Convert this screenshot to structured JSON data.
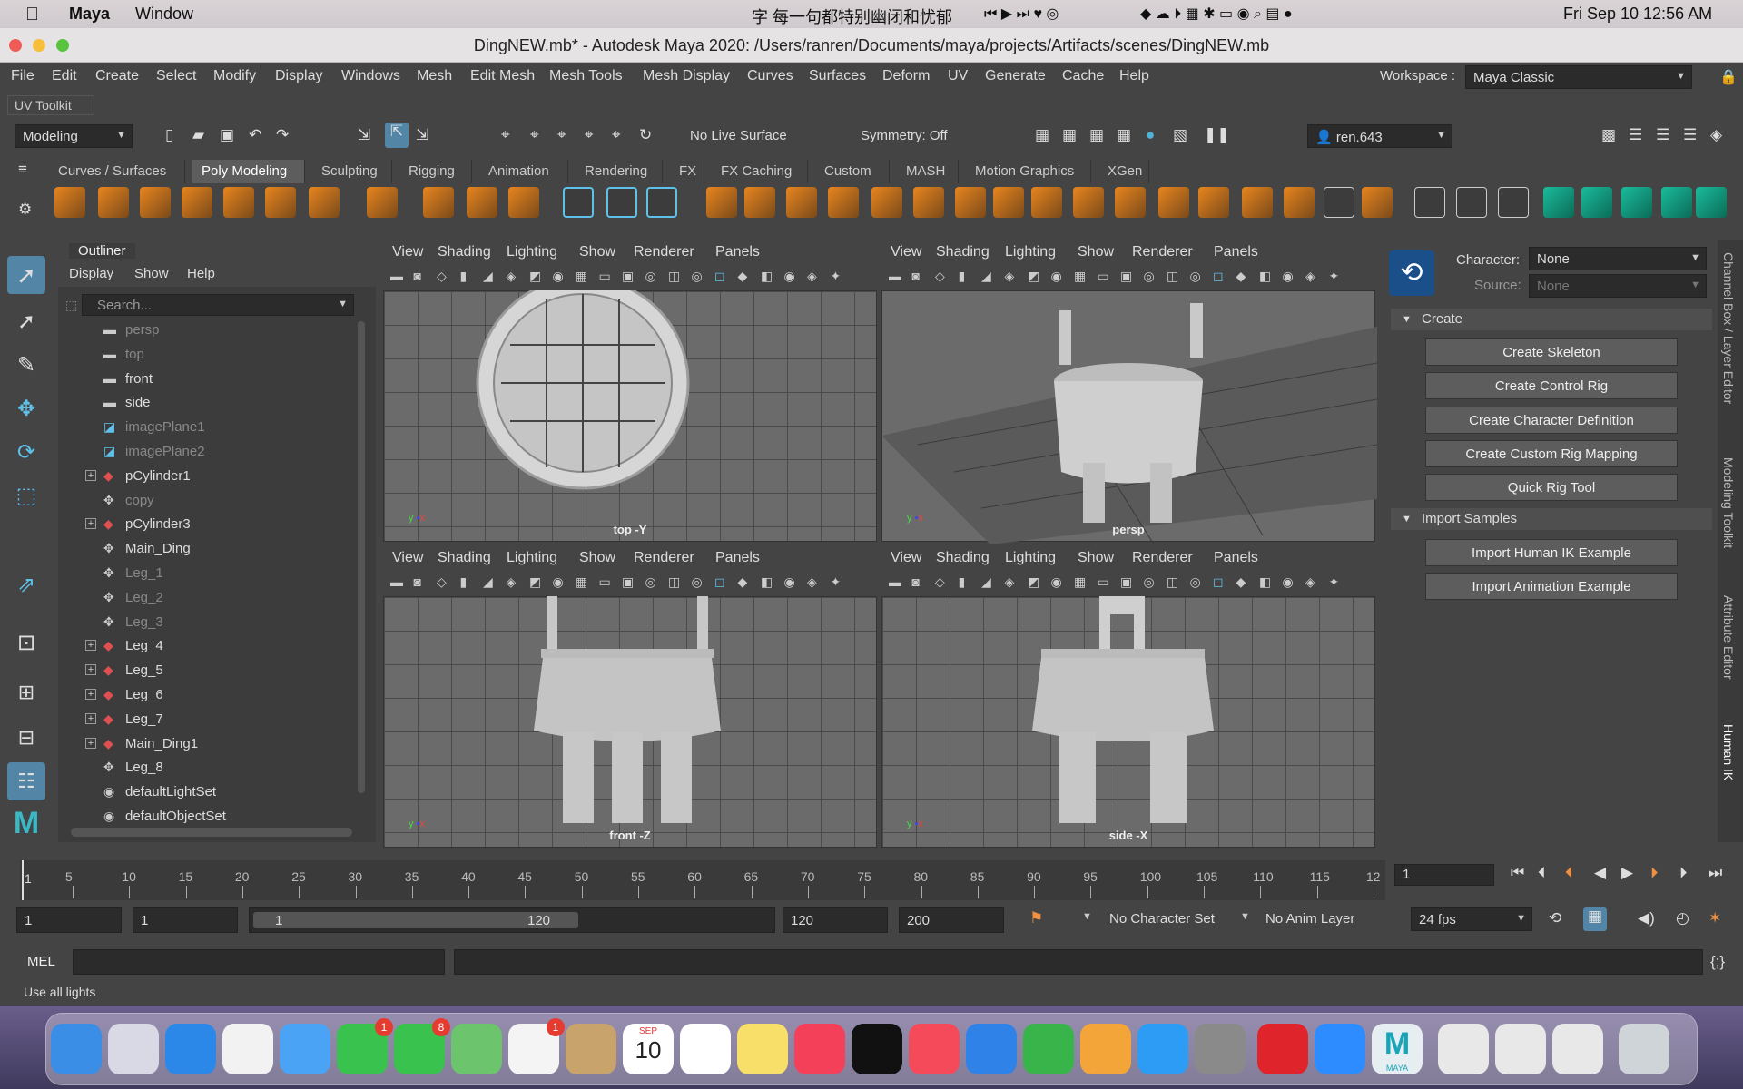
{
  "macmenu": {
    "apple": "",
    "app": "Maya",
    "items": [
      "Window"
    ],
    "input_text": "字 每一句都特别幽闭和忧郁",
    "clock": "Fri Sep 10  12:56 AM"
  },
  "window": {
    "title": "DingNEW.mb* - Autodesk Maya 2020: /Users/ranren/Documents/maya/projects/Artifacts/scenes/DingNEW.mb"
  },
  "menus": [
    "File",
    "Edit",
    "Create",
    "Select",
    "Modify",
    "Display",
    "Windows",
    "Mesh",
    "Edit Mesh",
    "Mesh Tools",
    "Mesh Display",
    "Curves",
    "Surfaces",
    "Deform",
    "UV",
    "Generate",
    "Cache",
    "Help"
  ],
  "workspace": {
    "label": "Workspace :",
    "value": "Maya Classic"
  },
  "uv_toolkit": "UV Toolkit",
  "statusline": {
    "mode": "Modeling",
    "live_surface": "No Live Surface",
    "symmetry": "Symmetry: Off",
    "user": "ren.643"
  },
  "shelf_tabs": [
    "Curves / Surfaces",
    "Poly Modeling",
    "Sculpting",
    "Rigging",
    "Animation",
    "Rendering",
    "FX",
    "FX Caching",
    "Custom",
    "MASH",
    "Motion Graphics",
    "XGen"
  ],
  "active_shelf": "Poly Modeling",
  "outliner": {
    "title": "Outliner",
    "menu": [
      "Display",
      "Show",
      "Help"
    ],
    "search_placeholder": "Search...",
    "items": [
      {
        "label": "persp",
        "icon": "camera-icon",
        "dim": true,
        "expand": false
      },
      {
        "label": "top",
        "icon": "camera-icon",
        "dim": true,
        "expand": false
      },
      {
        "label": "front",
        "icon": "camera-icon",
        "dim": false,
        "expand": false
      },
      {
        "label": "side",
        "icon": "camera-icon",
        "dim": false,
        "expand": false
      },
      {
        "label": "imagePlane1",
        "icon": "image-plane-icon",
        "dim": true,
        "expand": false
      },
      {
        "label": "imagePlane2",
        "icon": "image-plane-icon",
        "dim": true,
        "expand": false
      },
      {
        "label": "pCylinder1",
        "icon": "mesh-icon",
        "dim": false,
        "expand": true
      },
      {
        "label": "copy",
        "icon": "transform-icon",
        "dim": true,
        "expand": false
      },
      {
        "label": "pCylinder3",
        "icon": "mesh-icon",
        "dim": false,
        "expand": true
      },
      {
        "label": "Main_Ding",
        "icon": "transform-icon",
        "dim": false,
        "expand": false
      },
      {
        "label": "Leg_1",
        "icon": "transform-icon",
        "dim": true,
        "expand": false
      },
      {
        "label": "Leg_2",
        "icon": "transform-icon",
        "dim": true,
        "expand": false
      },
      {
        "label": "Leg_3",
        "icon": "transform-icon",
        "dim": true,
        "expand": false
      },
      {
        "label": "Leg_4",
        "icon": "mesh-icon",
        "dim": false,
        "expand": true
      },
      {
        "label": "Leg_5",
        "icon": "mesh-icon",
        "dim": false,
        "expand": true
      },
      {
        "label": "Leg_6",
        "icon": "mesh-icon",
        "dim": false,
        "expand": true
      },
      {
        "label": "Leg_7",
        "icon": "mesh-icon",
        "dim": false,
        "expand": true
      },
      {
        "label": "Main_Ding1",
        "icon": "mesh-icon",
        "dim": false,
        "expand": true
      },
      {
        "label": "Leg_8",
        "icon": "transform-icon",
        "dim": false,
        "expand": false
      },
      {
        "label": "defaultLightSet",
        "icon": "set-icon",
        "dim": false,
        "expand": false
      },
      {
        "label": "defaultObjectSet",
        "icon": "set-icon",
        "dim": false,
        "expand": false
      }
    ]
  },
  "viewport_menu": [
    "View",
    "Shading",
    "Lighting",
    "Show",
    "Renderer",
    "Panels"
  ],
  "viewports": [
    {
      "label": "top -Y"
    },
    {
      "label": "persp"
    },
    {
      "label": "front -Z"
    },
    {
      "label": "side -X"
    }
  ],
  "hik": {
    "character_label": "Character:",
    "character_value": "None",
    "source_label": "Source:",
    "source_value": "None",
    "create_header": "Create",
    "create_buttons": [
      "Create Skeleton",
      "Create Control Rig",
      "Create Character Definition",
      "Create Custom Rig Mapping",
      "Quick Rig Tool"
    ],
    "import_header": "Import Samples",
    "import_buttons": [
      "Import Human IK Example",
      "Import Animation Example"
    ]
  },
  "side_tabs": [
    "Channel Box / Layer Editor",
    "Modeling Toolkit",
    "Attribute Editor",
    "Human IK"
  ],
  "timeline": {
    "ticks": [
      "5",
      "10",
      "15",
      "20",
      "25",
      "30",
      "35",
      "40",
      "45",
      "50",
      "55",
      "60",
      "65",
      "70",
      "75",
      "80",
      "85",
      "90",
      "95",
      "100",
      "105",
      "110",
      "115",
      "12"
    ],
    "start_marker": "1",
    "current_frame": "1"
  },
  "range": {
    "start": "1",
    "start2": "1",
    "slider_min": "1",
    "slider_max": "120",
    "end": "120",
    "end2": "200",
    "character_set": "No Character Set",
    "anim_layer": "No Anim Layer",
    "fps": "24 fps"
  },
  "cmdline": {
    "label": "MEL"
  },
  "helpline": "Use all lights",
  "dock": {
    "calendar_month": "SEP",
    "calendar_day": "10",
    "maya_label": "MAYA",
    "badges": {
      "facetime": "1",
      "messages": "8",
      "photos": "1"
    }
  }
}
